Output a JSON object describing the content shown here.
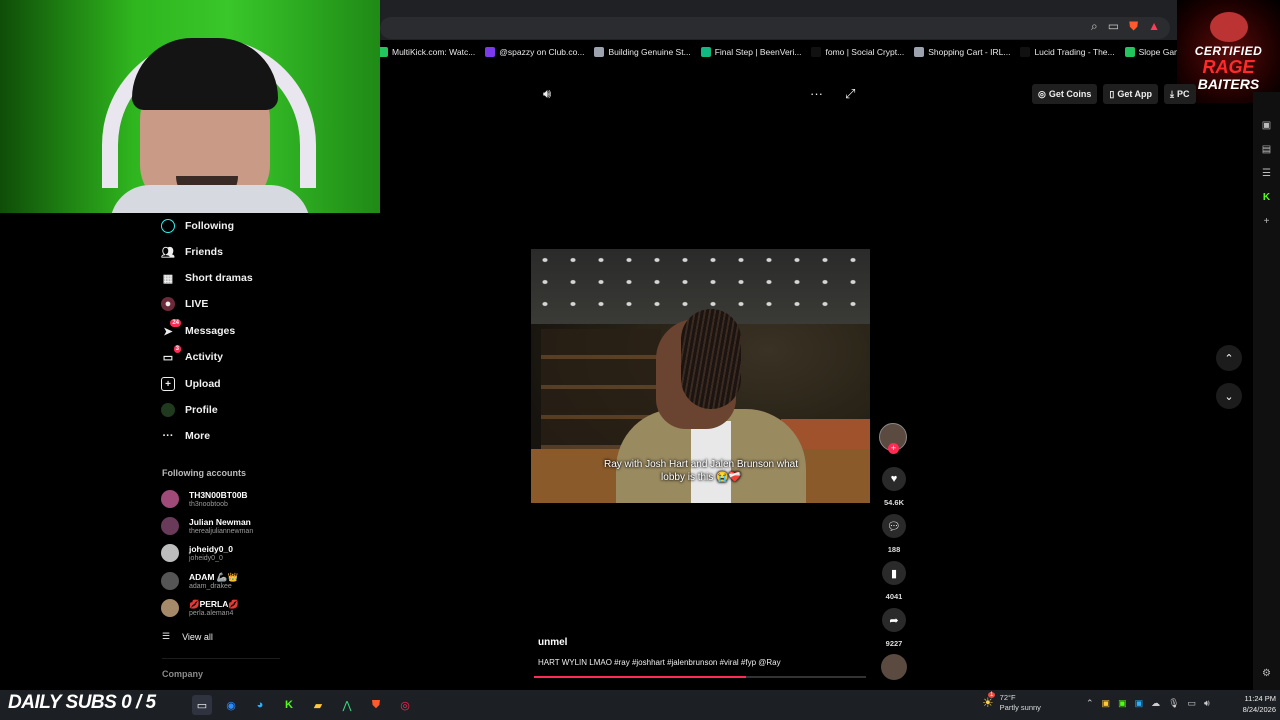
{
  "browser": {
    "bookmarks": [
      {
        "label": "MultiKick.com: Watc...",
        "color": "#22c55e"
      },
      {
        "label": "@spazzy on Club.co...",
        "color": "#7c3aed"
      },
      {
        "label": "Building Genuine St...",
        "color": "#9ca3af"
      },
      {
        "label": "Final Step | BeenVeri...",
        "color": "#10b981"
      },
      {
        "label": "fomo | Social Crypt...",
        "color": "#111111"
      },
      {
        "label": "Shopping Cart - IRL...",
        "color": "#9ca3af"
      },
      {
        "label": "Lucid Trading - The...",
        "color": "#111111"
      },
      {
        "label": "Slope Game",
        "color": "#22c55e"
      }
    ]
  },
  "logo": {
    "line1": "CERTIFIED",
    "line2": "RAGE",
    "line3": "BAITERS"
  },
  "header": {
    "get_coins": "Get Coins",
    "get_app": "Get App",
    "pc": "PC"
  },
  "sidebar": {
    "items": [
      {
        "label": "Following",
        "icon": "following-icon"
      },
      {
        "label": "Friends",
        "icon": "friends-icon"
      },
      {
        "label": "Short dramas",
        "icon": "short-dramas-icon"
      },
      {
        "label": "LIVE",
        "icon": "live-icon"
      },
      {
        "label": "Messages",
        "icon": "messages-icon",
        "badge": "24"
      },
      {
        "label": "Activity",
        "icon": "activity-icon",
        "badge": "3"
      },
      {
        "label": "Upload",
        "icon": "upload-icon"
      },
      {
        "label": "Profile",
        "icon": "profile-icon"
      },
      {
        "label": "More",
        "icon": "more-icon"
      }
    ],
    "following_title": "Following accounts",
    "accounts": [
      {
        "name": "TH3N00BT00B",
        "handle": "th3noobtoob"
      },
      {
        "name": "Julian Newman",
        "handle": "therealjuliannewman"
      },
      {
        "name": "joheidy0_0",
        "handle": "joheidy0_0"
      },
      {
        "name": "ADAM 🦾👑",
        "handle": "adam_drakee"
      },
      {
        "name": "💋PERLA💋",
        "handle": "perla.aleman4"
      }
    ],
    "view_all": "View all",
    "company": "Company"
  },
  "video": {
    "caption": "Ray with Josh Hart and Jalen Brunson what lobby is this 😭❤️‍🩹",
    "username": "unmel",
    "description": "HART WYLIN LMAO #ray #joshhart #jalenbrunson #viral #fyp @Ray",
    "progress": 0.64
  },
  "actions": {
    "likes": "54.6K",
    "comments": "188",
    "saves": "4041",
    "shares": "9227"
  },
  "taskbar": {
    "subs_goal": "DAILY SUBS 0 / 5",
    "weather_temp": "72°F",
    "weather_desc": "Partly sunny",
    "weather_badge": "1",
    "time": "11:24 PM",
    "date": "8/24/2026"
  },
  "colors": {
    "accent": "#fe2c55",
    "green_screen": "#2fb51e"
  }
}
